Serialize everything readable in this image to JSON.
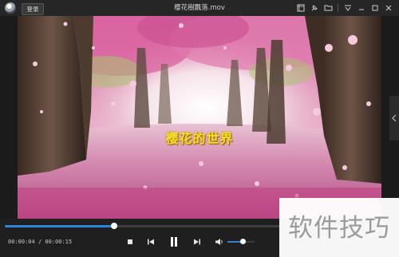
{
  "window": {
    "title": "樱花樹飄落.mov",
    "login_label": "登录"
  },
  "titlebar_icons": [
    "screenshot-icon",
    "pin-icon",
    "folder-icon",
    "settings-icon",
    "minimize-icon",
    "maximize-icon",
    "close-icon"
  ],
  "video": {
    "subtitle": "樱花的世界"
  },
  "playback": {
    "current_time": "00:00:04",
    "separator": "/",
    "total_time": "00:00:15",
    "progress": 0.28,
    "volume": 0.55
  },
  "controls": [
    "stop-icon",
    "previous-icon",
    "pause-icon",
    "next-icon",
    "volume-icon"
  ],
  "colors": {
    "accent": "#2f83d6",
    "titlebar": "#262626",
    "controls_bg": "#1f1f1f",
    "subtitle": "#f4e02a"
  },
  "watermark": {
    "text": "软件技巧"
  }
}
